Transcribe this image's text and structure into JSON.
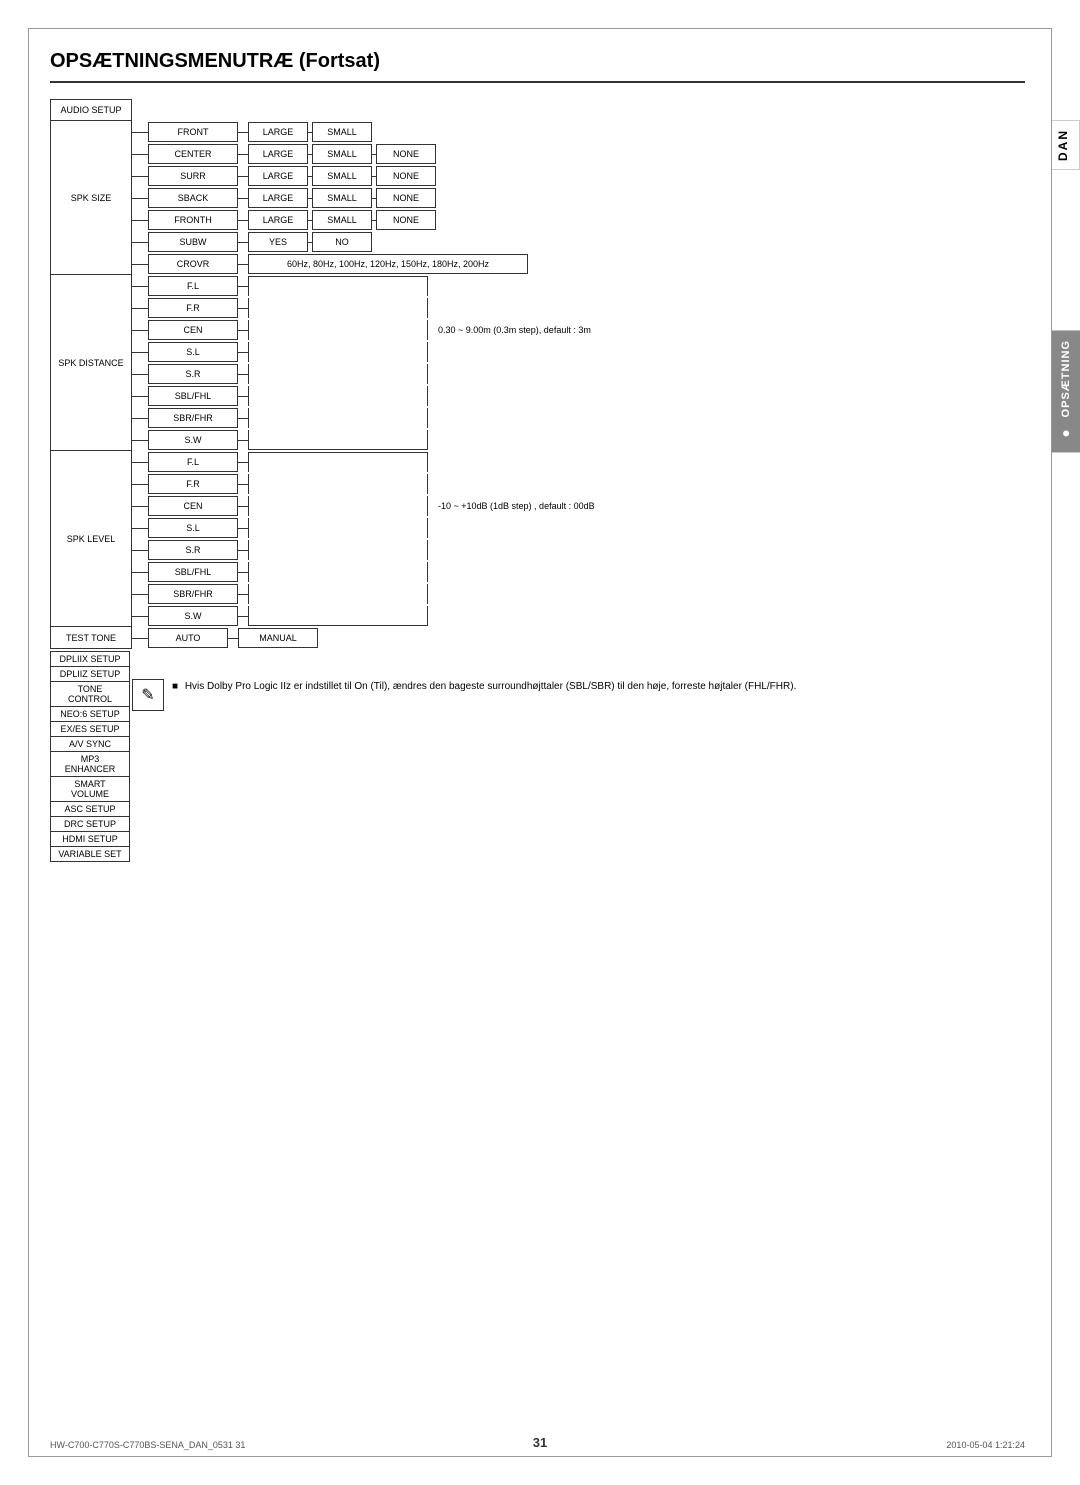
{
  "page": {
    "title": "OPSÆTNINGSMENUTRÆ (Fortsat)",
    "dan_tab": "DAN",
    "opsaetning_tab": "OPSÆTNING",
    "page_number": "31",
    "footer_left": "HW-C700-C770S-C770BS-SENA_DAN_0531  31",
    "footer_right": "2010-05-04   1:21:24"
  },
  "menu": {
    "audio_setup": "AUDIO SETUP",
    "spk_size": "SPK SIZE",
    "spk_distance": "SPK DISTANCE",
    "spk_level": "SPK LEVEL",
    "test_tone": "TEST TONE"
  },
  "spk_size_rows": [
    {
      "name": "FRONT",
      "opts": [
        "LARGE",
        "SMALL",
        ""
      ]
    },
    {
      "name": "CENTER",
      "opts": [
        "LARGE",
        "SMALL",
        "NONE"
      ]
    },
    {
      "name": "SURR",
      "opts": [
        "LARGE",
        "SMALL",
        "NONE"
      ]
    },
    {
      "name": "SBACK",
      "opts": [
        "LARGE",
        "SMALL",
        "NONE"
      ]
    },
    {
      "name": "FRONTH",
      "opts": [
        "LARGE",
        "SMALL",
        "NONE"
      ]
    },
    {
      "name": "SUBW",
      "opts": [
        "YES",
        "NO",
        ""
      ]
    },
    {
      "name": "CROVR",
      "opts": [
        "60Hz, 80Hz, 100Hz, 120Hz, 150Hz, 180Hz, 200Hz"
      ]
    }
  ],
  "spk_distance_rows": [
    "F.L",
    "F.R",
    "CEN",
    "S.L",
    "S.R",
    "SBL/FHL",
    "SBR/FHR",
    "S.W"
  ],
  "spk_distance_note": "0.30 ~ 9.00m (0.3m step), default : 3m",
  "spk_level_rows": [
    "F.L",
    "F.R",
    "CEN",
    "S.L",
    "S.R",
    "SBL/FHL",
    "SBR/FHR",
    "S.W"
  ],
  "spk_level_note": "-10 ~ +10dB (1dB step) , default : 00dB",
  "test_tone_opts": [
    "AUTO",
    "MANUAL"
  ],
  "bottom_items": [
    "DPLIIX SETUP",
    "DPLIIZ SETUP",
    "TONE CONTROL",
    "NEO:6 SETUP",
    "EX/ES SETUP",
    "A/V SYNC",
    "MP3 ENHANCER",
    "SMART VOLUME",
    "ASC SETUP",
    "DRC SETUP",
    "HDMI SETUP",
    "VARIABLE SET"
  ],
  "note": {
    "icon": "✎",
    "bullet": "■",
    "text": "Hvis Dolby Pro Logic IIz er indstillet til On (Til), ændres den bageste surroundhøjttaler (SBL/SBR) til den høje, forreste højtaler (FHL/FHR)."
  }
}
